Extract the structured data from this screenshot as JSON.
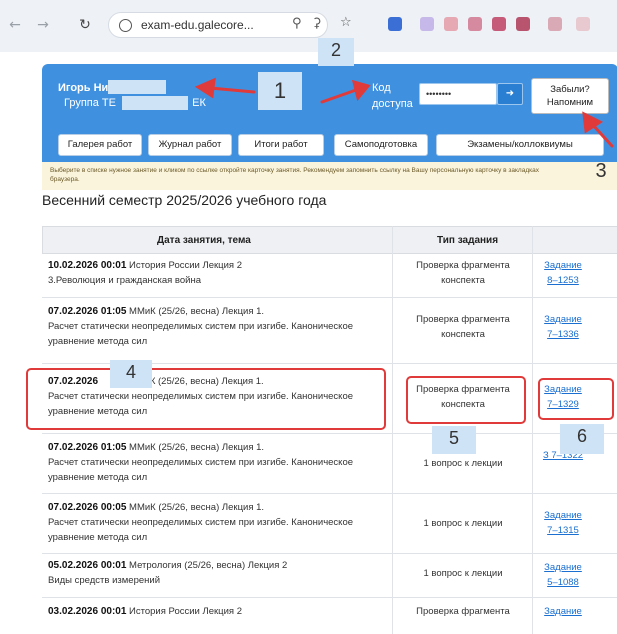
{
  "browser": {
    "url": "exam-edu.galecore...",
    "back_icon": "arrow-left-icon",
    "forward_icon": "arrow-right-icon",
    "reload_icon": "reload-icon"
  },
  "header": {
    "user_name": "Игорь Ни",
    "group_label": "Группа ТЕ",
    "group_suffix": "ЕК",
    "code_label": "Код доступа",
    "code_value": "••••••••",
    "forgot_label": "Забыли? Напомним"
  },
  "tabs": [
    "Галерея работ",
    "Журнал работ",
    "Итоги работ",
    "Самоподготовка",
    "Экзамены/коллоквиумы"
  ],
  "hint": "Выберите в списке нужное занятие и кликом по ссылке откройте карточку занятия. Рекомендуем запомнить ссылку на Вашу персональную карточку в закладках браузера.",
  "page_title": "Весенний семестр 2025/2026 учебного года",
  "table": {
    "headers": [
      "Дата занятия, тема",
      "Тип задания",
      ""
    ],
    "rows": [
      {
        "date": "10.02.2026 00:01",
        "course": "История России",
        "lecture": "Лекция 2",
        "topic": "3.Революция и гражданская война",
        "type": "Проверка фрагмента конспекта",
        "link": "Задание 8–1253"
      },
      {
        "date": "07.02.2026 01:05",
        "course": "ММиК (25/26, весна)",
        "lecture": "Лекция 1.",
        "topic": "Расчет статически неопределимых систем при изгибе. Каноническое уравнение метода сил",
        "type": "Проверка фрагмента конспекта",
        "link": "Задание 7–1336"
      },
      {
        "date": "07.02.2026",
        "course": "ММиК (25/26, весна)",
        "lecture": "Лекция 1.",
        "topic": "Расчет статически неопределимых систем при изгибе. Каноническое уравнение метода сил",
        "type": "Проверка фрагмента конспекта",
        "link": "Задание 7–1329"
      },
      {
        "date": "07.02.2026 01:05",
        "course": "ММиК (25/26, весна)",
        "lecture": "Лекция 1.",
        "topic": "Расчет статически неопределимых систем при изгибе. Каноническое уравнение метода сил",
        "type": "1 вопрос к лекции",
        "link": "З 7–1322"
      },
      {
        "date": "07.02.2026 00:05",
        "course": "ММиК (25/26, весна)",
        "lecture": "Лекция 1.",
        "topic": "Расчет статически неопределимых систем при изгибе. Каноническое уравнение метода сил",
        "type": "1 вопрос к лекции",
        "link": "Задание 7–1315"
      },
      {
        "date": "05.02.2026 00:01",
        "course": "Метрология (25/26, весна)",
        "lecture": "Лекция 2",
        "topic": "Виды средств измерений",
        "type": "1 вопрос к лекции",
        "link": "Задание 5–1088"
      },
      {
        "date": "03.02.2026 00:01",
        "course": "История России",
        "lecture": "Лекция 2",
        "topic": "",
        "type": "Проверка фрагмента",
        "link": "Задание"
      }
    ]
  },
  "annotations": [
    "1",
    "2",
    "3",
    "4",
    "5",
    "6"
  ],
  "colors": {
    "panel": "#3f91e0",
    "annotation": "#e03a3a",
    "link": "#1a6fd0"
  }
}
